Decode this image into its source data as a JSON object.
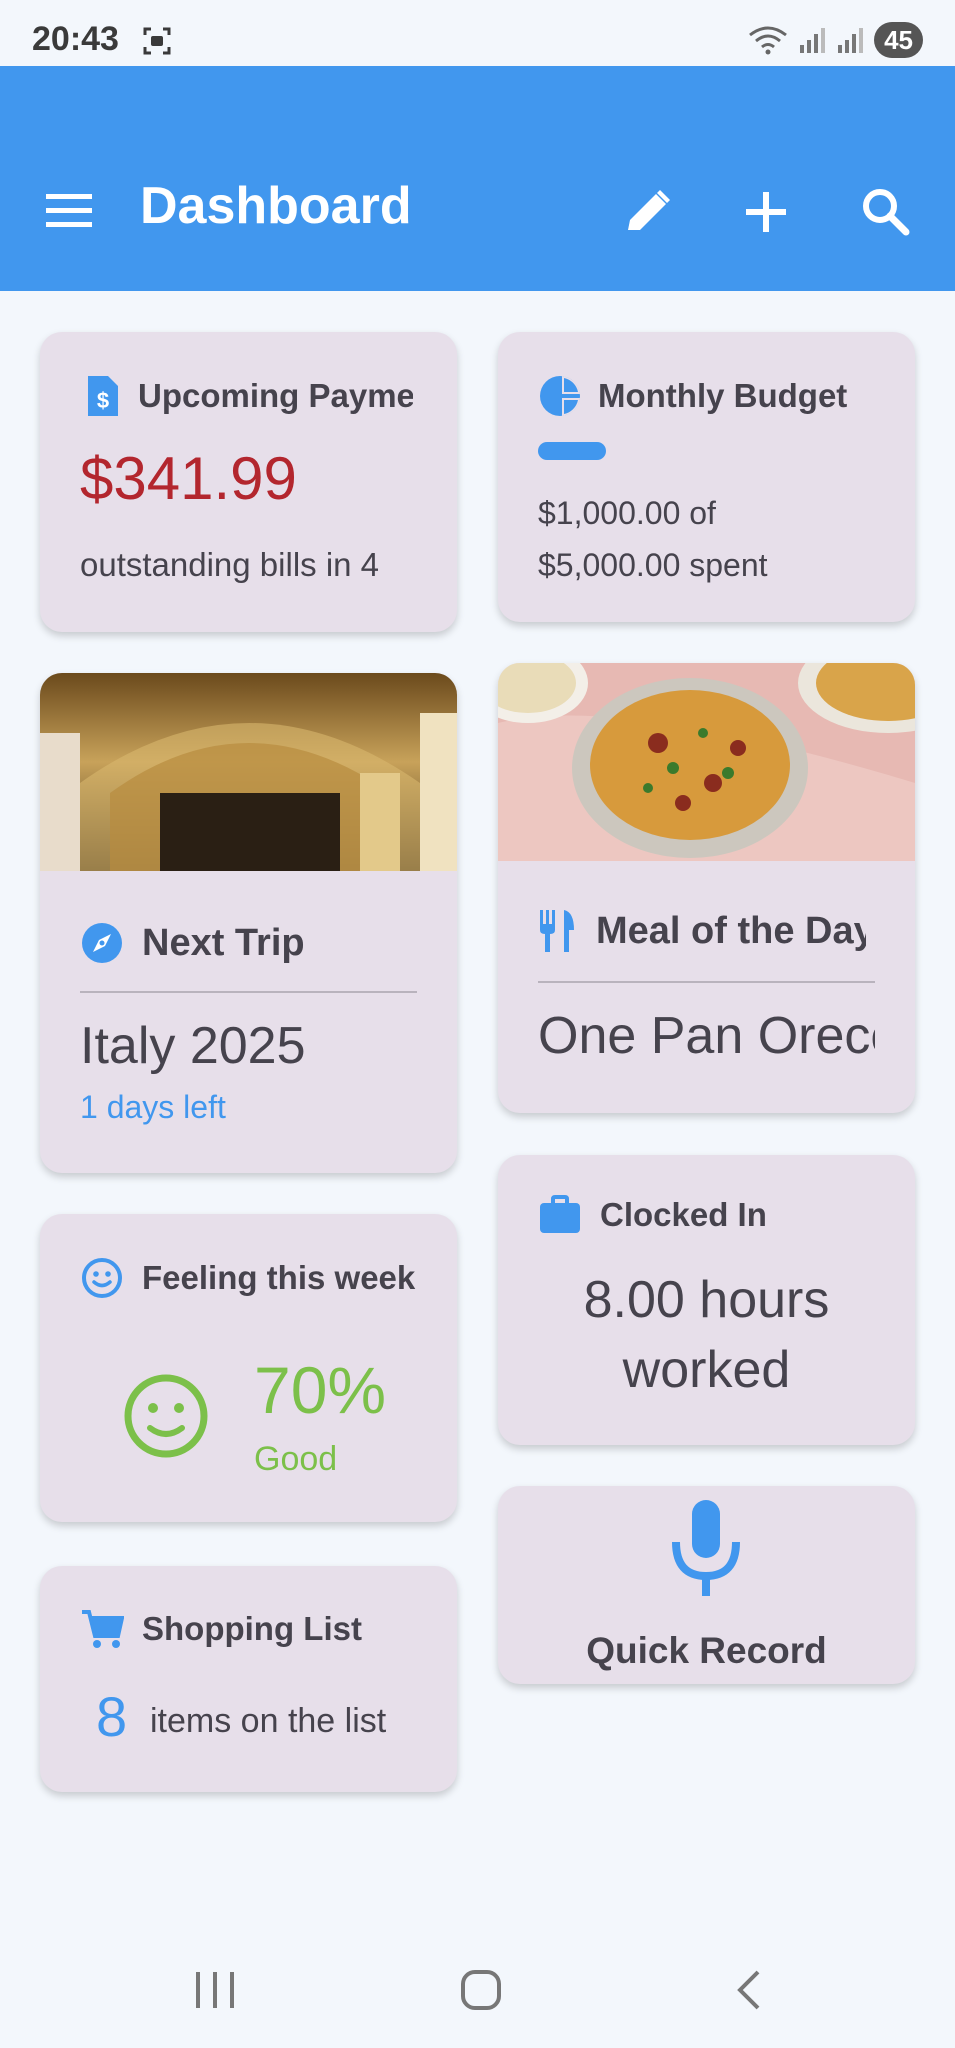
{
  "status_bar": {
    "time": "20:43",
    "battery": "45"
  },
  "app_bar": {
    "title": "Dashboard"
  },
  "colors": {
    "primary": "#4197ee",
    "card": "#e7dfea",
    "payment": "#b3262e",
    "good": "#7cc04a",
    "accent_text": "#4197ee"
  },
  "cards": {
    "payments": {
      "title": "Upcoming Payments",
      "amount": "$341.99",
      "subtitle": "outstanding bills in 4"
    },
    "budget": {
      "title": "Monthly Budget",
      "spent_line1": "$1,000.00 of",
      "spent_line2": "$5,000.00 spent",
      "progress": 0.2
    },
    "trip": {
      "title": "Next Trip",
      "destination": "Italy 2025",
      "days_left": "1 days left"
    },
    "meal": {
      "title": "Meal of the Day",
      "dish": "One Pan Orecchiette"
    },
    "feeling": {
      "title": "Feeling this week",
      "percent": "70%",
      "label": "Good"
    },
    "clocked": {
      "title": "Clocked In",
      "hours_line1": "8.00 hours",
      "hours_line2": "worked"
    },
    "record": {
      "label": "Quick Record"
    },
    "shopping": {
      "title": "Shopping List",
      "count": "8",
      "label": "items on the list"
    }
  },
  "icons": [
    "menu-icon",
    "edit-icon",
    "add-icon",
    "search-icon",
    "invoice-icon",
    "pie-chart-icon",
    "compass-icon",
    "utensils-icon",
    "smiley-icon",
    "briefcase-icon",
    "microphone-icon",
    "cart-icon"
  ]
}
